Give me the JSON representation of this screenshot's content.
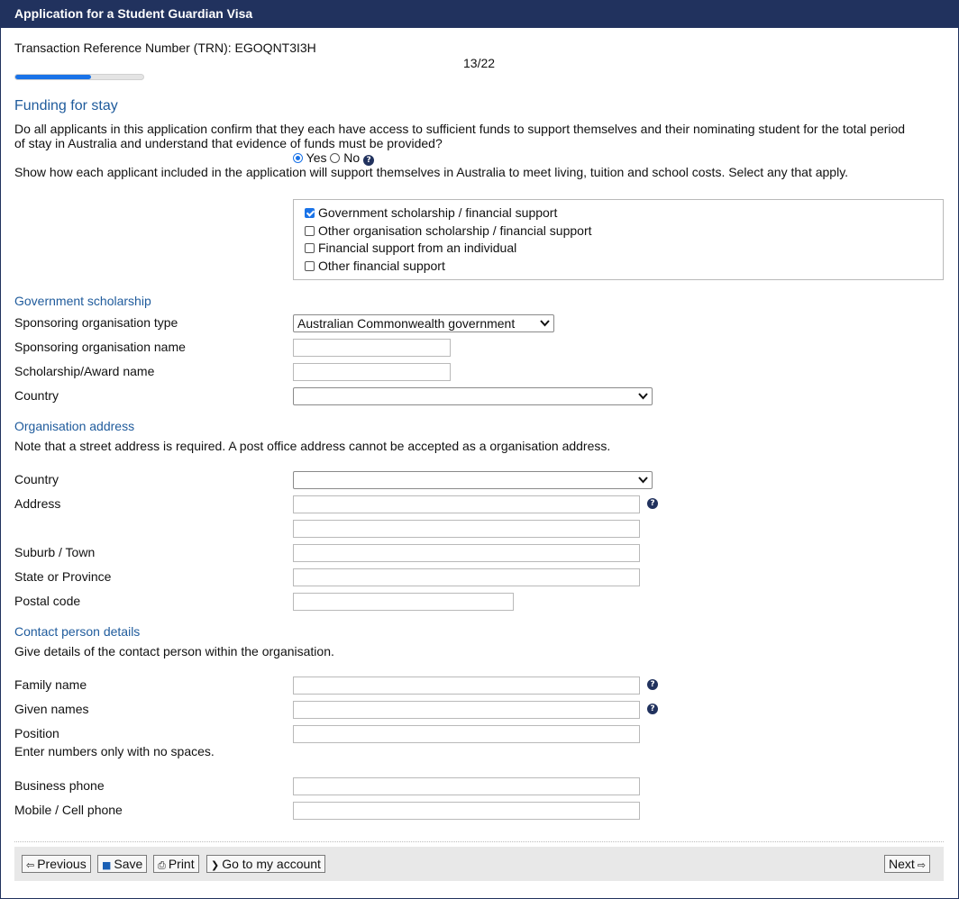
{
  "window": {
    "title": "Application for a Student Guardian Visa"
  },
  "trn": {
    "text": "Transaction Reference Number (TRN): EGOQNT3I3H"
  },
  "progress": {
    "page": "13/22",
    "fraction": 0.59
  },
  "funding": {
    "heading": "Funding for stay",
    "question": "Do all applicants in this application confirm that they each have access to sufficient funds to support themselves and their nominating student for the total period",
    "question_line2": "of stay in Australia and understand that evidence of funds must be provided?",
    "yes_label": "Yes",
    "no_label": "No",
    "selected": "Yes",
    "show_how": "Show how each applicant included in the application will support themselves in Australia to meet living, tuition and school costs. Select any that apply.",
    "options": [
      {
        "label": "Government scholarship / financial support",
        "checked": true
      },
      {
        "label": "Other organisation scholarship / financial support",
        "checked": false
      },
      {
        "label": "Financial support from an individual",
        "checked": false
      },
      {
        "label": "Other financial support",
        "checked": false
      }
    ]
  },
  "gov": {
    "heading": "Government scholarship",
    "org_type_label": "Sponsoring organisation type",
    "org_type_value": "Australian Commonwealth government",
    "org_name_label": "Sponsoring organisation name",
    "award_label": "Scholarship/Award name",
    "country_label": "Country",
    "country_value": ""
  },
  "org_address": {
    "heading": "Organisation address",
    "note": "Note that a street address is required. A post office address cannot be accepted as a organisation address.",
    "country_label": "Country",
    "country_value": "",
    "address_label": "Address",
    "suburb_label": "Suburb / Town",
    "state_label": "State or Province",
    "postal_label": "Postal code"
  },
  "contact": {
    "heading": "Contact person details",
    "note": "Give details of the contact person within the organisation.",
    "family_label": "Family name",
    "given_label": "Given names",
    "position_label": "Position",
    "numbers_note": "Enter numbers only with no spaces.",
    "business_label": "Business phone",
    "mobile_label": "Mobile / Cell phone"
  },
  "footer": {
    "previous": "Previous",
    "save": "Save",
    "print": "Print",
    "account": "Go to my account",
    "next": "Next"
  },
  "colors": {
    "titlebar": "#21325e",
    "heading": "#1f5b9c",
    "accent": "#1a73e8"
  }
}
